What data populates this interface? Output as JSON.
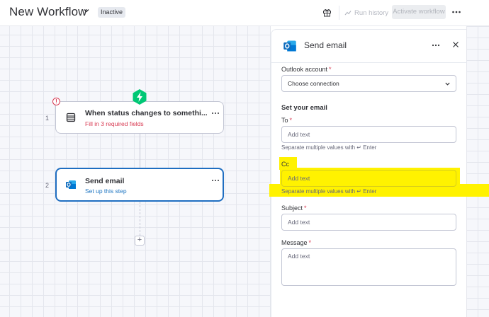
{
  "header": {
    "title": "New Workflow",
    "status": "Inactive",
    "run_history": "Run history",
    "activate": "Activate workflow"
  },
  "workflow": {
    "steps": [
      {
        "number": "1",
        "title": "When status changes to somethi...",
        "subtitle": "Fill in 3 required fields",
        "error_mark": "!"
      },
      {
        "number": "2",
        "title": "Send email",
        "subtitle": "Set up this step"
      }
    ],
    "add_step": "+"
  },
  "panel": {
    "title": "Send email",
    "outlook_account": {
      "label": "Outlook account",
      "required": "*",
      "value": "Choose connection"
    },
    "section_title": "Set your email",
    "to": {
      "label": "To",
      "required": "*",
      "placeholder": "Add text",
      "helper": "Separate multiple values with ↵ Enter"
    },
    "cc": {
      "label": "Cc",
      "placeholder": "Add text",
      "helper": "Separate multiple values with ↵ Enter"
    },
    "subject": {
      "label": "Subject",
      "required": "*",
      "placeholder": "Add text"
    },
    "message": {
      "label": "Message",
      "required": "*",
      "placeholder": "Add text"
    }
  },
  "colors": {
    "primary": "#1f6ec1",
    "error": "#d83a52",
    "trigger_badge": "#00c875",
    "outlook": "#0f6cbd",
    "highlight": "#fff200"
  },
  "icons": [
    "chevron-down-icon",
    "gift-icon",
    "run-history-icon",
    "more-icon",
    "table-icon",
    "outlook-icon",
    "close-icon",
    "lightning-icon"
  ]
}
